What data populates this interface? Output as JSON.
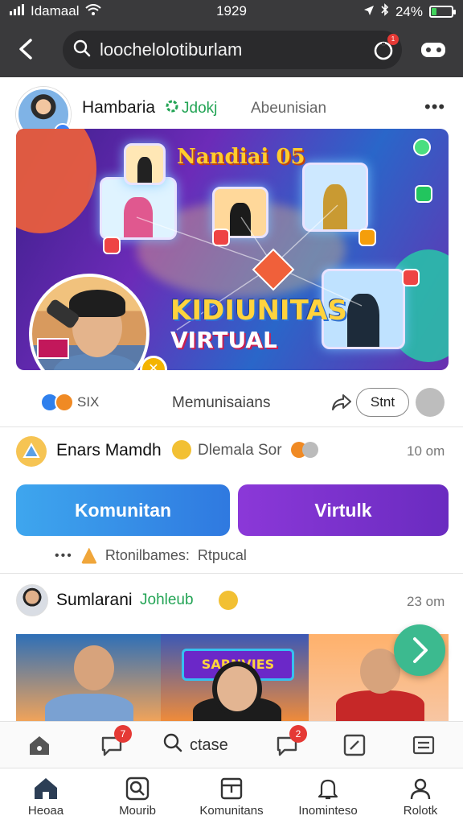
{
  "status_bar": {
    "carrier": "Idamaal",
    "time": "1929",
    "battery": "24%",
    "battery_level": 0.24
  },
  "header": {
    "search_text": "loochelolotiburlam",
    "notification_count": "1",
    "icons": [
      "back-arrow-icon",
      "search-icon",
      "notification-icon",
      "gamepad-icon"
    ]
  },
  "post1": {
    "author": "Hambaria",
    "tag": "Jdokj",
    "subtitle": "Abeunisian",
    "banner": {
      "title": "Nandiai 05",
      "headline_line1": "KIDIUNITAS",
      "headline_line2": "VIRTUAL"
    },
    "reaction_count": "SIX",
    "comments_label": "Memunisaians",
    "share_label": "Stnt"
  },
  "comment": {
    "name": "Enars Mamdh",
    "text": "Dlemala Sor",
    "time": "10 om"
  },
  "buttons": {
    "primary": "Komunitan",
    "secondary": "Virtulk"
  },
  "meta": {
    "dots": "•••",
    "label1": "Rtonilbames:",
    "label2": "Rtpucal"
  },
  "post2": {
    "author": "Sumlarani",
    "tag": "Johleub",
    "time": "23 om",
    "sign_text": "SARNVIES"
  },
  "toolbar": {
    "badge1": "7",
    "badge2": "2",
    "search_label": "ctase"
  },
  "bottom_nav": {
    "items": [
      {
        "label": "Heoaa",
        "icon": "home-icon"
      },
      {
        "label": "Mourib",
        "icon": "search-icon"
      },
      {
        "label": "Komunitans",
        "icon": "community-icon"
      },
      {
        "label": "Inominteso",
        "icon": "bell-icon"
      },
      {
        "label": "Rolotk",
        "icon": "profile-icon"
      }
    ]
  },
  "colors": {
    "header_bg": "#3a3a3c",
    "primary_button": "#2f80ed",
    "secondary_button": "#7a30c9",
    "tag_green": "#23a455",
    "fab": "#3cba8f",
    "badge_red": "#e53935"
  }
}
